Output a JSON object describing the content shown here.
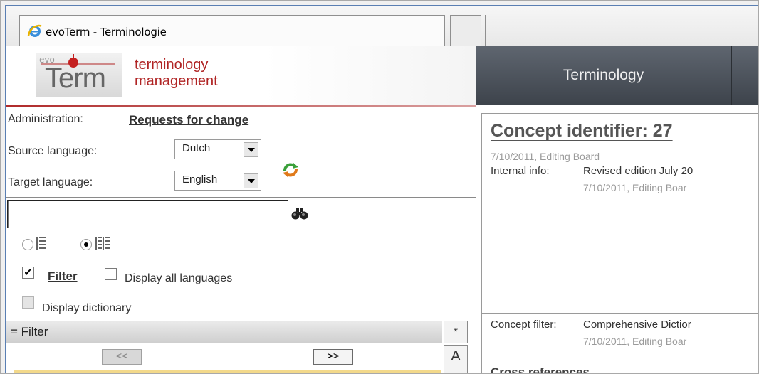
{
  "browser": {
    "tab_title": "evoTerm - Terminologie",
    "icon": "ie-icon"
  },
  "header": {
    "logo_word": "Term",
    "logo_sub_line1": "terminology",
    "logo_sub_line2": "management",
    "nav_items": [
      "Terminology"
    ]
  },
  "left": {
    "admin_label": "Administration:",
    "admin_link": "Requests for change",
    "source_label": "Source language:",
    "source_value": "Dutch",
    "target_label": "Target language:",
    "target_value": "English",
    "search_value": "",
    "filter_link": "Filter",
    "display_all_languages": "Display all languages",
    "display_dictionary": "Display dictionary",
    "filter_bar": "= Filter",
    "pager_prev": "<<",
    "pager_next": ">>",
    "side_star": "*",
    "side_a": "A"
  },
  "right": {
    "concept_title": "Concept identifier: 27",
    "created_meta": "7/10/2011, Editing Board",
    "internal_label": "Internal info:",
    "internal_value": "Revised edition July 20",
    "internal_meta": "7/10/2011, Editing Boar",
    "concept_filter_label": "Concept filter:",
    "concept_filter_value": "Comprehensive Dictior",
    "concept_filter_meta": "7/10/2011, Editing Boar",
    "cross_refs": "Cross references"
  },
  "colors": {
    "brand_red": "#b02424",
    "nav_bg": "#4a5058",
    "frame_blue": "#5a7fb3"
  }
}
